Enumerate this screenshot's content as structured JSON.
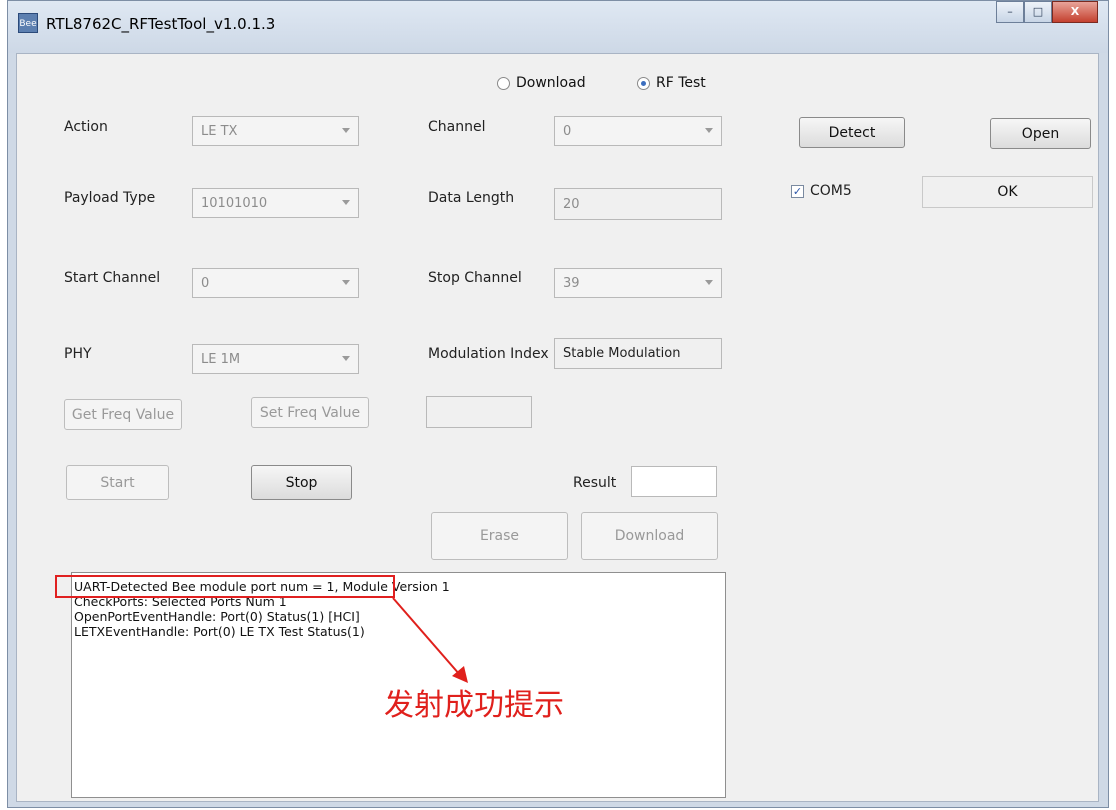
{
  "window": {
    "title": "RTL8762C_RFTestTool_v1.0.1.3",
    "icon_text": "Bee",
    "minimize": "–",
    "maximize": "□",
    "close": "X"
  },
  "mode": {
    "download": "Download",
    "rf_test": "RF Test",
    "selected": "RF Test"
  },
  "form": {
    "action_label": "Action",
    "action_value": "LE TX",
    "channel_label": "Channel",
    "channel_value": "0",
    "payload_label": "Payload Type",
    "payload_value": "10101010",
    "datalen_label": "Data Length",
    "datalen_value": "20",
    "startch_label": "Start Channel",
    "startch_value": "0",
    "stopch_label": "Stop Channel",
    "stopch_value": "39",
    "phy_label": "PHY",
    "phy_value": "LE 1M",
    "modidx_label": "Modulation Index",
    "modidx_value": "Stable Modulation"
  },
  "buttons": {
    "get_freq": "Get Freq Value",
    "set_freq": "Set Freq Value",
    "start": "Start",
    "stop": "Stop",
    "result_label": "Result",
    "erase": "Erase",
    "download": "Download",
    "detect": "Detect",
    "open": "Open"
  },
  "port": {
    "name": "COM5",
    "checked": true,
    "status": "OK"
  },
  "log": {
    "lines": [
      "UART-Detected Bee module port num = 1, Module Version 1",
      "CheckPorts: Selected Ports Num 1",
      "OpenPortEventHandle: Port(0) Status(1) [HCI]",
      "LETXEventHandle: Port(0) LE TX Test Status(1)"
    ]
  },
  "annotation": {
    "text": "发射成功提示",
    "color": "#e0201c"
  }
}
